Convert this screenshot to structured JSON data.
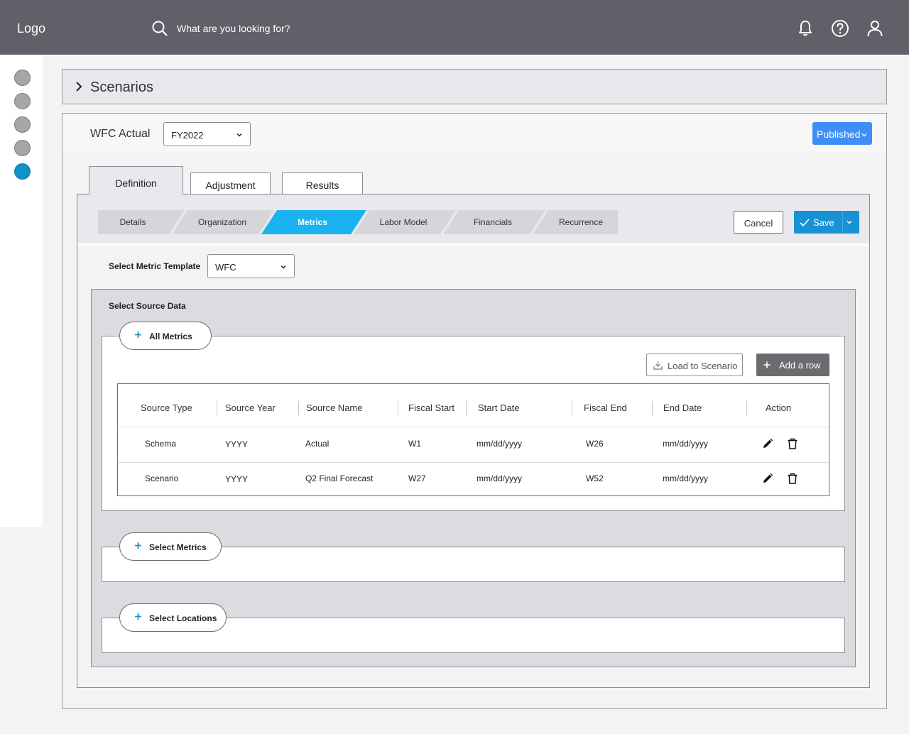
{
  "topbar": {
    "logo": "Logo",
    "search_placeholder": "What are you looking for?",
    "icons": [
      "search-icon",
      "bell-icon",
      "help-icon",
      "user-icon"
    ]
  },
  "sidebar": {
    "items": [
      {
        "icon": "nav-dot",
        "active": false
      },
      {
        "icon": "nav-dot",
        "active": false
      },
      {
        "icon": "nav-dot",
        "active": false
      },
      {
        "icon": "nav-dot",
        "active": false
      },
      {
        "icon": "nav-dot",
        "active": true
      }
    ],
    "active_color": "#1192c6"
  },
  "scenarios": {
    "title": "Scenarios",
    "icon": "chevron-right-icon"
  },
  "main": {
    "title": "WFC Actual",
    "year_select": {
      "value": "FY2022"
    },
    "status_button": {
      "label": "Published",
      "color": "#3e8ef7"
    },
    "tabs": [
      {
        "label": "Definition",
        "active": true
      },
      {
        "label": "Adjustment",
        "active": false
      },
      {
        "label": "Results",
        "active": false
      }
    ],
    "steps": [
      {
        "label": "Details",
        "active": false
      },
      {
        "label": "Organization",
        "active": false
      },
      {
        "label": "Metrics",
        "active": true
      },
      {
        "label": "Labor Model",
        "active": false
      },
      {
        "label": "Financials",
        "active": false
      },
      {
        "label": "Recurrence",
        "active": false
      }
    ],
    "step_active_color": "#1ab3ef",
    "actions": {
      "cancel_label": "Cancel",
      "save_label": "Save",
      "save_color": "#1792d4"
    },
    "template": {
      "label": "Select Metric Template",
      "value": "WFC"
    },
    "source": {
      "label": "Select Source Data",
      "all_metrics_label": "All Metrics",
      "load_label": "Load to Scenario",
      "add_row_label": "Add a row",
      "table": {
        "columns": [
          "Source Type",
          "Source Year",
          "Source Name",
          "Fiscal Start",
          "Start Date",
          "Fiscal End",
          "End Date",
          "Action"
        ],
        "rows": [
          [
            "Schema",
            "YYYY",
            "Actual",
            "W1",
            "mm/dd/yyyy",
            "W26",
            "mm/dd/yyyy"
          ],
          [
            "Scenario",
            "YYYY",
            "Q2 Final Forecast",
            "W27",
            "mm/dd/yyyy",
            "W52",
            "mm/dd/yyyy"
          ]
        ],
        "row_actions": [
          "edit-icon",
          "delete-icon"
        ]
      },
      "select_metrics_label": "Select Metrics",
      "select_locations_label": "Select Locations"
    }
  }
}
